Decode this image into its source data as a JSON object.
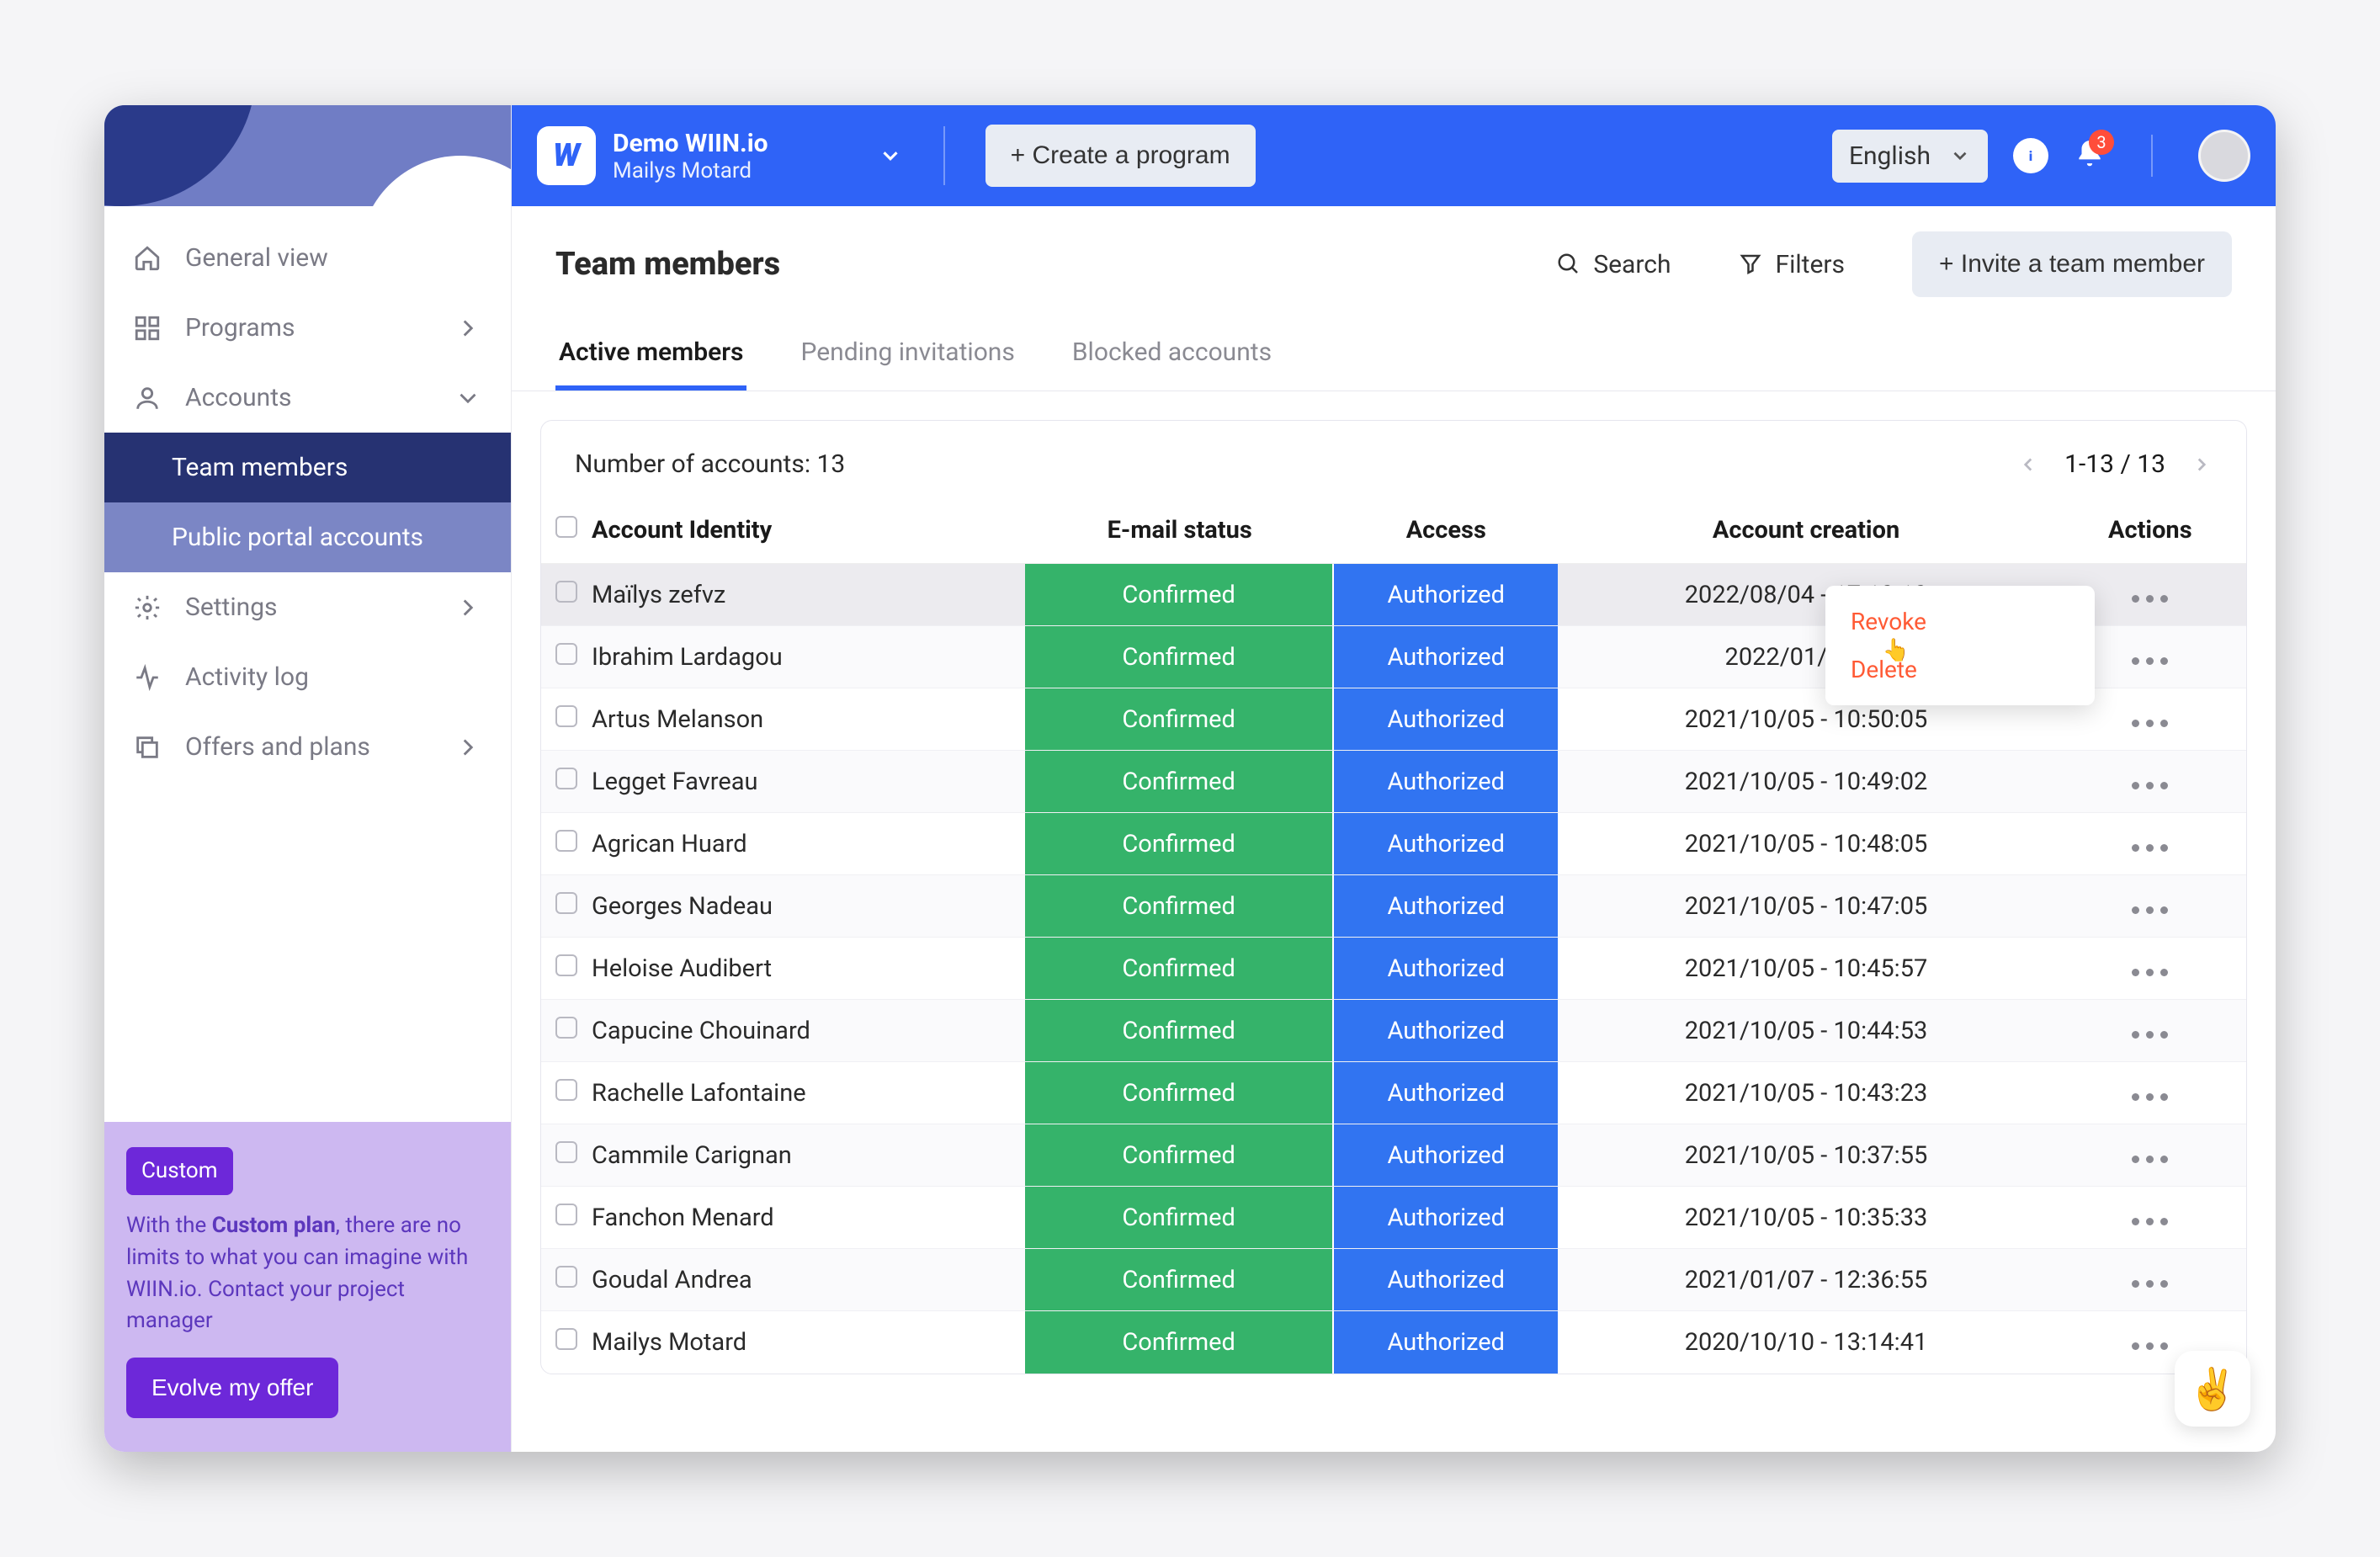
{
  "header": {
    "brand": "Demo WIIN.io",
    "user": "Mailys Motard",
    "create_btn": "+ Create a program",
    "language": "English",
    "notif_count": "3"
  },
  "sidebar": {
    "items": [
      {
        "label": "General view"
      },
      {
        "label": "Programs"
      },
      {
        "label": "Accounts"
      },
      {
        "label": "Settings"
      },
      {
        "label": "Activity log"
      },
      {
        "label": "Offers and plans"
      }
    ],
    "sub": {
      "team": "Team members",
      "public": "Public portal accounts"
    },
    "offer": {
      "badge": "Custom",
      "line_pre": "With the ",
      "plan": "Custom plan",
      "line_post": ", there are no limits to what you can imagine with WIIN.io. Contact your project manager",
      "cta": "Evolve my offer"
    }
  },
  "page": {
    "title": "Team members",
    "search": "Search",
    "filters": "Filters",
    "invite": "+ Invite a team member"
  },
  "tabs": {
    "active": "Active members",
    "pending": "Pending invitations",
    "blocked": "Blocked accounts"
  },
  "table": {
    "count_label": "Number of accounts: 13",
    "pager": "1-13 / 13",
    "cols": {
      "identity": "Account Identity",
      "email": "E-mail status",
      "access": "Access",
      "creation": "Account creation",
      "actions": "Actions"
    },
    "email_val": "Confirmed",
    "access_val": "Authorized",
    "rows": [
      {
        "name": "Maïlys zefvz",
        "created": "2022/08/04 - 17:12:12"
      },
      {
        "name": "Ibrahim Lardagou",
        "created": "2022/01/12 - 1"
      },
      {
        "name": "Artus Melanson",
        "created": "2021/10/05 - 10:50:05"
      },
      {
        "name": "Legget Favreau",
        "created": "2021/10/05 - 10:49:02"
      },
      {
        "name": "Agrican Huard",
        "created": "2021/10/05 - 10:48:05"
      },
      {
        "name": "Georges Nadeau",
        "created": "2021/10/05 - 10:47:05"
      },
      {
        "name": "Heloise Audibert",
        "created": "2021/10/05 - 10:45:57"
      },
      {
        "name": "Capucine Chouinard",
        "created": "2021/10/05 - 10:44:53"
      },
      {
        "name": "Rachelle Lafontaine",
        "created": "2021/10/05 - 10:43:23"
      },
      {
        "name": "Cammile Carignan",
        "created": "2021/10/05 - 10:37:55"
      },
      {
        "name": "Fanchon Menard",
        "created": "2021/10/05 - 10:35:33"
      },
      {
        "name": "Goudal Andrea",
        "created": "2021/01/07 - 12:36:55"
      },
      {
        "name": "Mailys Motard",
        "created": "2020/10/10 - 13:14:41"
      }
    ]
  },
  "menu": {
    "revoke": "Revoke",
    "delete": "Delete"
  },
  "emoji": "✌️"
}
